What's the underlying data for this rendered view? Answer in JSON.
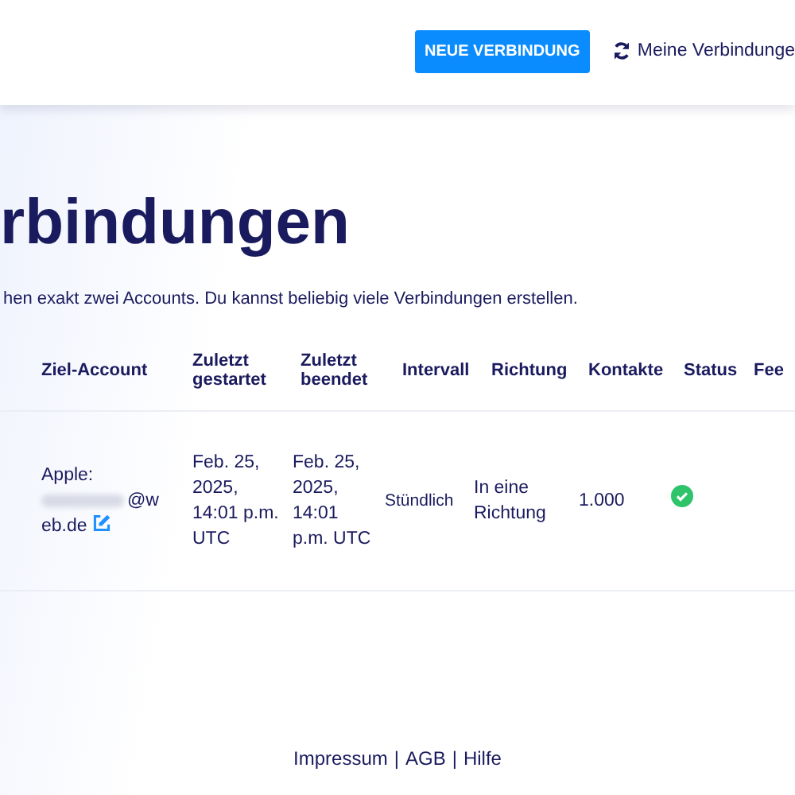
{
  "header": {
    "new_button": "NEUE VERBINDUNG",
    "my_connections_link": "Meine Verbindunge"
  },
  "title": "rbindungen",
  "description": "hen exakt zwei Accounts. Du kannst beliebig viele Verbindungen erstellen.",
  "table": {
    "columns": [
      "Ziel-Account",
      "Zuletzt gestartet",
      "Zuletzt beendet",
      "Intervall",
      "Richtung",
      "Kontakte",
      "Status",
      "Fee"
    ],
    "rows": [
      {
        "target_prefix": "Apple:",
        "target_domain_line1": "@w",
        "target_domain_line2": "eb.de",
        "started": "Feb. 25, 2025, 14:01 p.m. UTC",
        "ended": "Feb. 25, 2025, 14:01 p.m. UTC",
        "interval": "Stündlich",
        "direction": "In eine Richtung",
        "contacts": "1.000",
        "status_ok": true
      }
    ]
  },
  "footer": {
    "links": [
      "Impressum",
      "AGB",
      "Hilfe"
    ],
    "separator": "|"
  }
}
